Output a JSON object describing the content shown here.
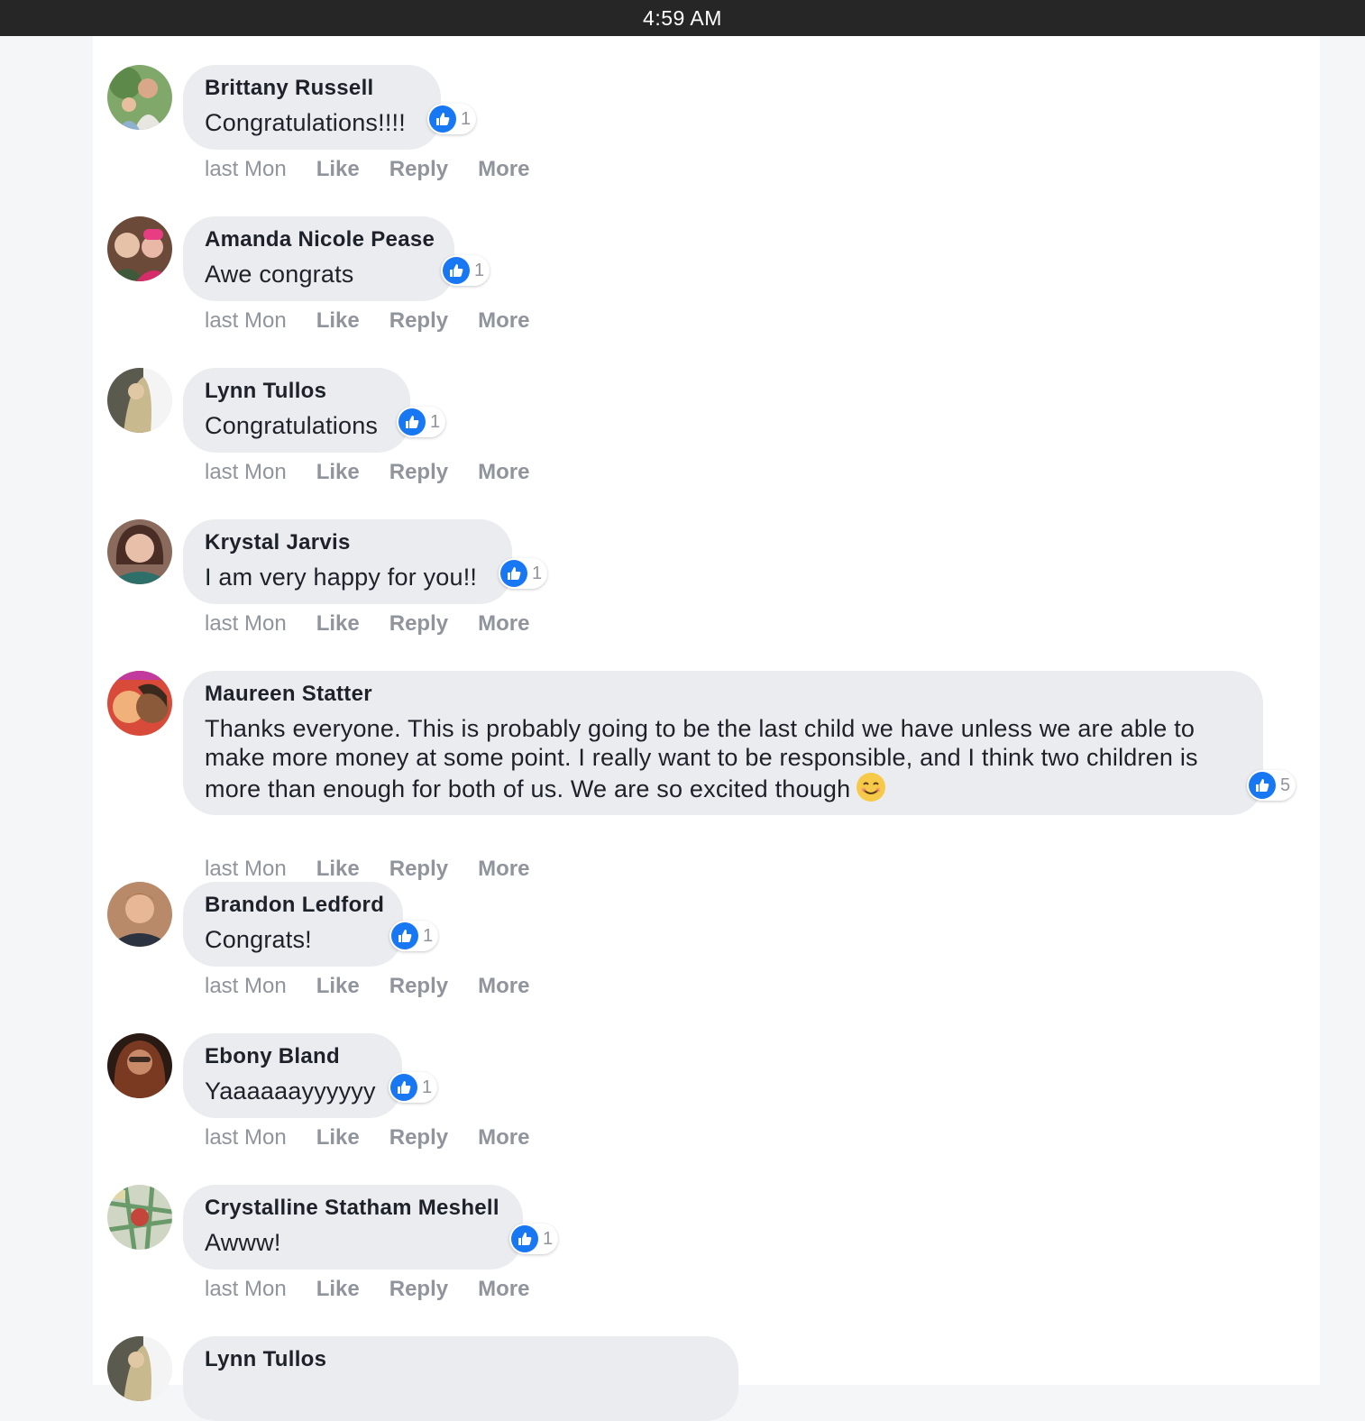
{
  "status_bar": {
    "time": "4:59 AM"
  },
  "action_labels": {
    "like": "Like",
    "reply": "Reply",
    "more": "More"
  },
  "colors": {
    "like_blue": "#1877f2",
    "bubble_gray": "#ebecef",
    "meta_gray": "#90949c"
  },
  "comments": [
    {
      "author": "Brittany Russell",
      "text": "Congratulations!!!!",
      "reactions": "1",
      "time": "last Mon",
      "reaction_icon": "like-icon"
    },
    {
      "author": "Amanda Nicole Pease",
      "text": "Awe congrats",
      "reactions": "1",
      "time": "last Mon",
      "reaction_icon": "like-icon"
    },
    {
      "author": "Lynn Tullos",
      "text": "Congratulations",
      "reactions": "1",
      "time": "last Mon",
      "reaction_icon": "like-icon"
    },
    {
      "author": "Krystal Jarvis",
      "text": "I am very happy for you!!",
      "reactions": "1",
      "time": "last Mon",
      "reaction_icon": "like-icon"
    },
    {
      "author": "Maureen Statter",
      "text": "Thanks everyone. This is probably going to be the last child we have unless we are able to make more money at some point. I really want to be responsible, and I think two children is more than enough for both of us. We are so excited though",
      "emoji": "smiling-face-emoji",
      "reactions": "5",
      "time": "last Mon",
      "reaction_icon": "like-icon"
    },
    {
      "author": "Brandon Ledford",
      "text": "Congrats!",
      "reactions": "1",
      "time": "last Mon",
      "reaction_icon": "like-icon"
    },
    {
      "author": "Ebony Bland",
      "text": "Yaaaaaayyyyyy",
      "reactions": "1",
      "time": "last Mon",
      "reaction_icon": "like-icon"
    },
    {
      "author": "Crystalline Statham Meshell",
      "text": "Awww!",
      "reactions": "1",
      "time": "last Mon",
      "reaction_icon": "like-icon"
    },
    {
      "author": "Lynn Tullos"
    }
  ]
}
